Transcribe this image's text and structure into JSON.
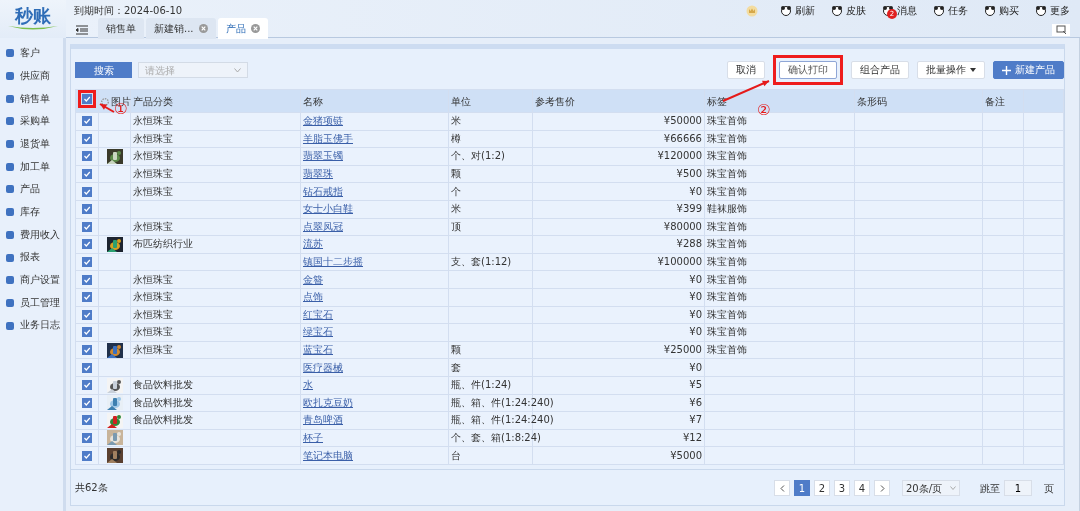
{
  "app": {
    "logo": "秒账",
    "expiry": "到期时间：2024-06-10"
  },
  "toolbar": [
    {
      "label": "刷新"
    },
    {
      "label": "皮肤"
    },
    {
      "label": "消息",
      "badge": "2"
    },
    {
      "label": "任务"
    },
    {
      "label": "购买"
    },
    {
      "label": "更多"
    }
  ],
  "tabs": [
    {
      "label": "销售单",
      "selected": false,
      "closable": false
    },
    {
      "label": "新建销...",
      "selected": false,
      "closable": true
    },
    {
      "label": "产品",
      "selected": true,
      "closable": true
    }
  ],
  "sidebar": {
    "items": [
      {
        "label": "客户"
      },
      {
        "label": "供应商"
      },
      {
        "label": "销售单"
      },
      {
        "label": "采购单"
      },
      {
        "label": "退货单"
      },
      {
        "label": "加工单"
      },
      {
        "label": "产品"
      },
      {
        "label": "库存"
      },
      {
        "label": "费用收入"
      },
      {
        "label": "报表"
      },
      {
        "label": "商户设置"
      },
      {
        "label": "员工管理"
      },
      {
        "label": "业务日志"
      }
    ]
  },
  "filter": {
    "search_button": "搜索",
    "select_placeholder": "请选择"
  },
  "actions": [
    {
      "label": "取消",
      "kind": "plain",
      "highlighted": false
    },
    {
      "label": "确认打印",
      "kind": "outline",
      "highlighted": true
    },
    {
      "label": "组合产品",
      "kind": "plain",
      "highlighted": false
    },
    {
      "label": "批量操作",
      "kind": "dropdown",
      "highlighted": false
    },
    {
      "label": "新建产品",
      "kind": "primary",
      "highlighted": false
    }
  ],
  "table": {
    "all_checked": true,
    "header_highlighted": true,
    "columns": [
      "图片",
      "产品分类",
      "名称",
      "单位",
      "参考售价",
      "标签",
      "条形码",
      "备注"
    ],
    "rows": [
      {
        "checked": true,
        "category": "永恒珠宝",
        "name": "金猪项链",
        "unit": "米",
        "price": "¥50000",
        "tag": "珠宝首饰"
      },
      {
        "checked": true,
        "category": "永恒珠宝",
        "name": "羊脂玉佛手",
        "unit": "樽",
        "price": "¥66666",
        "tag": "珠宝首饰"
      },
      {
        "checked": true,
        "category": "永恒珠宝",
        "name": "翡翠玉镯",
        "unit": "个、对(1:2)",
        "price": "¥120000",
        "tag": "珠宝首饰"
      },
      {
        "checked": true,
        "category": "永恒珠宝",
        "name": "翡翠珠",
        "unit": "颗",
        "price": "¥500",
        "tag": "珠宝首饰"
      },
      {
        "checked": true,
        "category": "永恒珠宝",
        "name": "钻石戒指",
        "unit": "个",
        "price": "¥0",
        "tag": "珠宝首饰"
      },
      {
        "checked": true,
        "name": "女士小白鞋",
        "unit": "米",
        "price": "¥399",
        "tag": "鞋袜服饰"
      },
      {
        "checked": true,
        "category": "永恒珠宝",
        "name": "点翠凤冠",
        "unit": "顶",
        "price": "¥80000",
        "tag": "珠宝首饰"
      },
      {
        "checked": true,
        "category": "布匹纺织行业",
        "name": "流苏",
        "price": "¥288",
        "tag": "珠宝首饰"
      },
      {
        "checked": true,
        "name": "镇国十二步摇",
        "unit": "支、套(1:12)",
        "price": "¥100000",
        "tag": "珠宝首饰"
      },
      {
        "checked": true,
        "category": "永恒珠宝",
        "name": "金簪",
        "price": "¥0",
        "tag": "珠宝首饰"
      },
      {
        "checked": true,
        "category": "永恒珠宝",
        "name": "点饰",
        "price": "¥0",
        "tag": "珠宝首饰"
      },
      {
        "checked": true,
        "category": "永恒珠宝",
        "name": "红宝石",
        "price": "¥0",
        "tag": "珠宝首饰"
      },
      {
        "checked": true,
        "category": "永恒珠宝",
        "name": "绿宝石",
        "price": "¥0",
        "tag": "珠宝首饰"
      },
      {
        "checked": true,
        "category": "永恒珠宝",
        "name": "蓝宝石",
        "unit": "颗",
        "price": "¥25000",
        "tag": "珠宝首饰"
      },
      {
        "checked": true,
        "name": "医疗器械",
        "unit": "套",
        "price": "¥0"
      },
      {
        "checked": true,
        "category": "食品饮料批发",
        "name": "水",
        "unit": "瓶、件(1:24)",
        "price": "¥5"
      },
      {
        "checked": true,
        "category": "食品饮料批发",
        "name": "欧扎克豆奶",
        "unit": "瓶、箱、件(1:24:240)",
        "price": "¥6"
      },
      {
        "checked": true,
        "category": "食品饮料批发",
        "name": "青岛啤酒",
        "unit": "瓶、箱、件(1:24:240)",
        "price": "¥7"
      },
      {
        "checked": true,
        "name": "杯子",
        "unit": "个、套、箱(1:8:24)",
        "price": "¥12"
      },
      {
        "checked": true,
        "name": "笔记本电脑",
        "unit": "台",
        "price": "¥5000"
      }
    ]
  },
  "footer": {
    "total": "共62条",
    "pages": [
      {
        "label": "1",
        "selected": true
      },
      {
        "label": "2",
        "selected": false
      },
      {
        "label": "3",
        "selected": false
      },
      {
        "label": "4",
        "selected": false
      }
    ],
    "page_size": "20条/页",
    "jump_label": "跳至",
    "jump_value": "1",
    "page_unit": "页"
  },
  "annotations": [
    {
      "label": "①"
    },
    {
      "label": "②"
    }
  ]
}
